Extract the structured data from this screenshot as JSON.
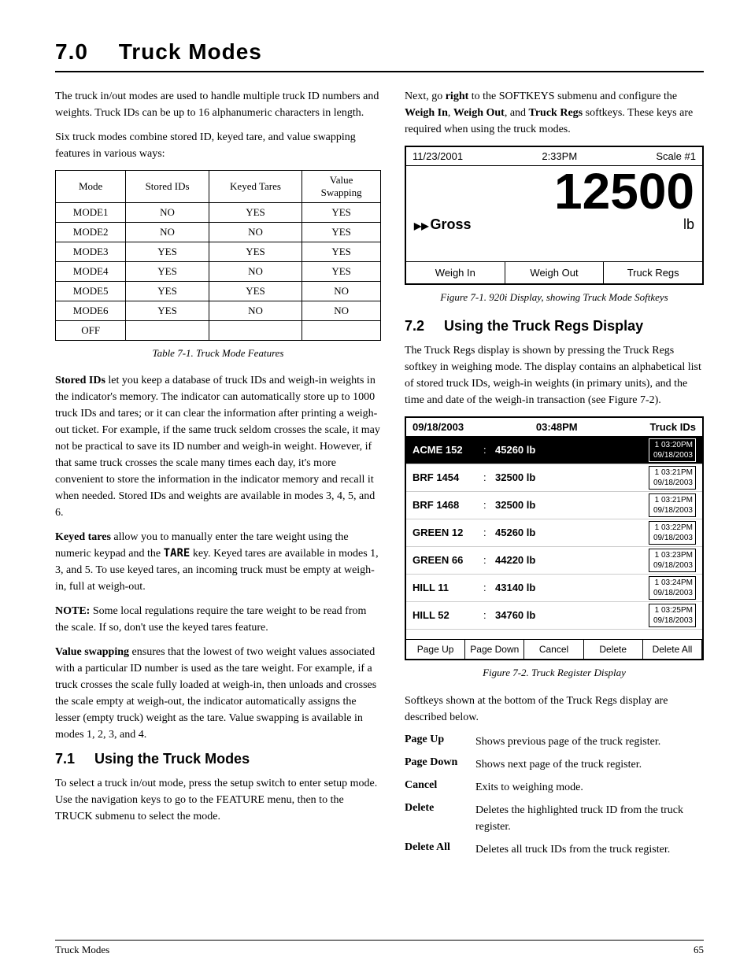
{
  "page": {
    "title": "7.0",
    "title_label": "Truck Modes",
    "footer_left": "Truck Modes",
    "footer_right": "65"
  },
  "intro": {
    "para1": "The truck in/out modes are used to handle multiple truck ID numbers and weights. Truck IDs can be up to 16 alphanumeric characters in length.",
    "para2": "Six truck modes combine stored ID, keyed tare, and value swapping features in various ways:",
    "para3_right": "Next, go right to the SOFTKEYS submenu and configure the Weigh In, Weigh Out, and Truck Regs softkeys. These keys are required when using the truck modes."
  },
  "table": {
    "caption": "Table 7-1. Truck Mode Features",
    "headers": [
      "Mode",
      "Stored IDs",
      "Keyed Tares",
      "Value Swapping"
    ],
    "rows": [
      [
        "MODE1",
        "NO",
        "YES",
        "YES"
      ],
      [
        "MODE2",
        "NO",
        "NO",
        "YES"
      ],
      [
        "MODE3",
        "YES",
        "YES",
        "YES"
      ],
      [
        "MODE4",
        "YES",
        "NO",
        "YES"
      ],
      [
        "MODE5",
        "YES",
        "YES",
        "NO"
      ],
      [
        "MODE6",
        "YES",
        "NO",
        "NO"
      ],
      [
        "OFF",
        "",
        "",
        ""
      ]
    ]
  },
  "scale_display": {
    "date": "11/23/2001",
    "time": "2:33PM",
    "scale": "Scale #1",
    "weight": "12500",
    "mode": "Gross",
    "unit": "lb",
    "softkeys": [
      "Weigh In",
      "Weigh Out",
      "Truck Regs"
    ],
    "figure_caption": "Figure 7-1. 920i Display, showing Truck Mode Softkeys"
  },
  "stored_ids": {
    "term": "Stored IDs",
    "text": "let you keep a database of truck IDs and weigh-in weights in the indicator's memory. The indicator can automatically store up to 1000 truck IDs and tares; or it can clear the information after printing a weigh-out ticket. For example, if the same truck seldom crosses the scale, it may not be practical to save its ID number and weigh-in weight. However, if that same truck crosses the scale many times each day, it's more convenient to store the information in the indicator memory and recall it when needed. Stored IDs and weights are available in modes 3, 4, 5, and 6."
  },
  "keyed_tares": {
    "term": "Keyed tares",
    "text": "allow you to manually enter the tare weight using the numeric keypad and the TARE key. Keyed tares are available in modes 1, 3, and 5. To use keyed tares, an incoming truck must be empty at weigh-in, full at weigh-out."
  },
  "note": {
    "label": "NOTE:",
    "text": "Some local regulations require the tare weight to be read from the scale. If so, don't use the keyed tares feature."
  },
  "value_swapping": {
    "term": "Value swapping",
    "text": "ensures that the lowest of two weight values associated with a particular ID number is used as the tare weight. For example, if a truck crosses the scale fully loaded at weigh-in, then unloads and crosses the scale empty at weigh-out, the indicator automatically assigns the lesser (empty truck) weight as the tare. Value swapping is available in modes 1, 2, 3, and 4."
  },
  "section71": {
    "num": "7.1",
    "title": "Using the Truck Modes",
    "text": "To select a truck in/out mode, press the setup switch to enter setup mode. Use the navigation keys to go to the FEATURE menu, then to the TRUCK submenu to select the mode."
  },
  "section72": {
    "num": "7.2",
    "title": "Using the Truck Regs Display",
    "intro": "The Truck Regs display is shown by pressing the Truck Regs softkey in weighing mode. The display contains an alphabetical list of stored truck IDs, weigh-in weights (in primary units), and the time and date of the weigh-in transaction (see Figure 7-2)."
  },
  "truck_display": {
    "date": "09/18/2003",
    "time": "03:48PM",
    "label": "Truck IDs",
    "rows": [
      {
        "id": "ACME 152",
        "colon": ":",
        "weight": "45260 lb",
        "badge": "1",
        "badgetime": "03:20PM",
        "badgedate": "09/18/2003",
        "highlighted": true
      },
      {
        "id": "BRF 1454",
        "colon": ":",
        "weight": "32500 lb",
        "badge": "1",
        "badgetime": "03:21PM",
        "badgedate": "09/18/2003",
        "highlighted": false
      },
      {
        "id": "BRF 1468",
        "colon": ":",
        "weight": "32500 lb",
        "badge": "1",
        "badgetime": "03:21PM",
        "badgedate": "09/18/2003",
        "highlighted": false
      },
      {
        "id": "GREEN 12",
        "colon": ":",
        "weight": "45260 lb",
        "badge": "1",
        "badgetime": "03:22PM",
        "badgedate": "09/18/2003",
        "highlighted": false
      },
      {
        "id": "GREEN 66",
        "colon": ":",
        "weight": "44220 lb",
        "badge": "1",
        "badgetime": "03:23PM",
        "badgedate": "09/18/2003",
        "highlighted": false
      },
      {
        "id": "HILL 11",
        "colon": ":",
        "weight": "43140 lb",
        "badge": "1",
        "badgetime": "03:24PM",
        "badgedate": "09/18/2003",
        "highlighted": false
      },
      {
        "id": "HILL 52",
        "colon": ":",
        "weight": "34760 lb",
        "badge": "1",
        "badgetime": "03:25PM",
        "badgedate": "09/18/2003",
        "highlighted": false
      }
    ],
    "softkeys": [
      "Page Up",
      "Page Down",
      "Cancel",
      "Delete",
      "Delete All"
    ],
    "figure_caption": "Figure 7-2. Truck Register Display"
  },
  "softkeys_desc": {
    "intro": "Softkeys shown at the bottom of the Truck Regs display are described below.",
    "items": [
      {
        "term": "Page Up",
        "def": "Shows previous page of the truck register."
      },
      {
        "term": "Page Down",
        "def": "Shows next page of the truck register."
      },
      {
        "term": "Cancel",
        "def": "Exits to weighing mode."
      },
      {
        "term": "Delete",
        "def": "Deletes the highlighted truck ID from the truck register."
      },
      {
        "term": "Delete All",
        "def": "Deletes all truck IDs from the truck register."
      }
    ]
  }
}
